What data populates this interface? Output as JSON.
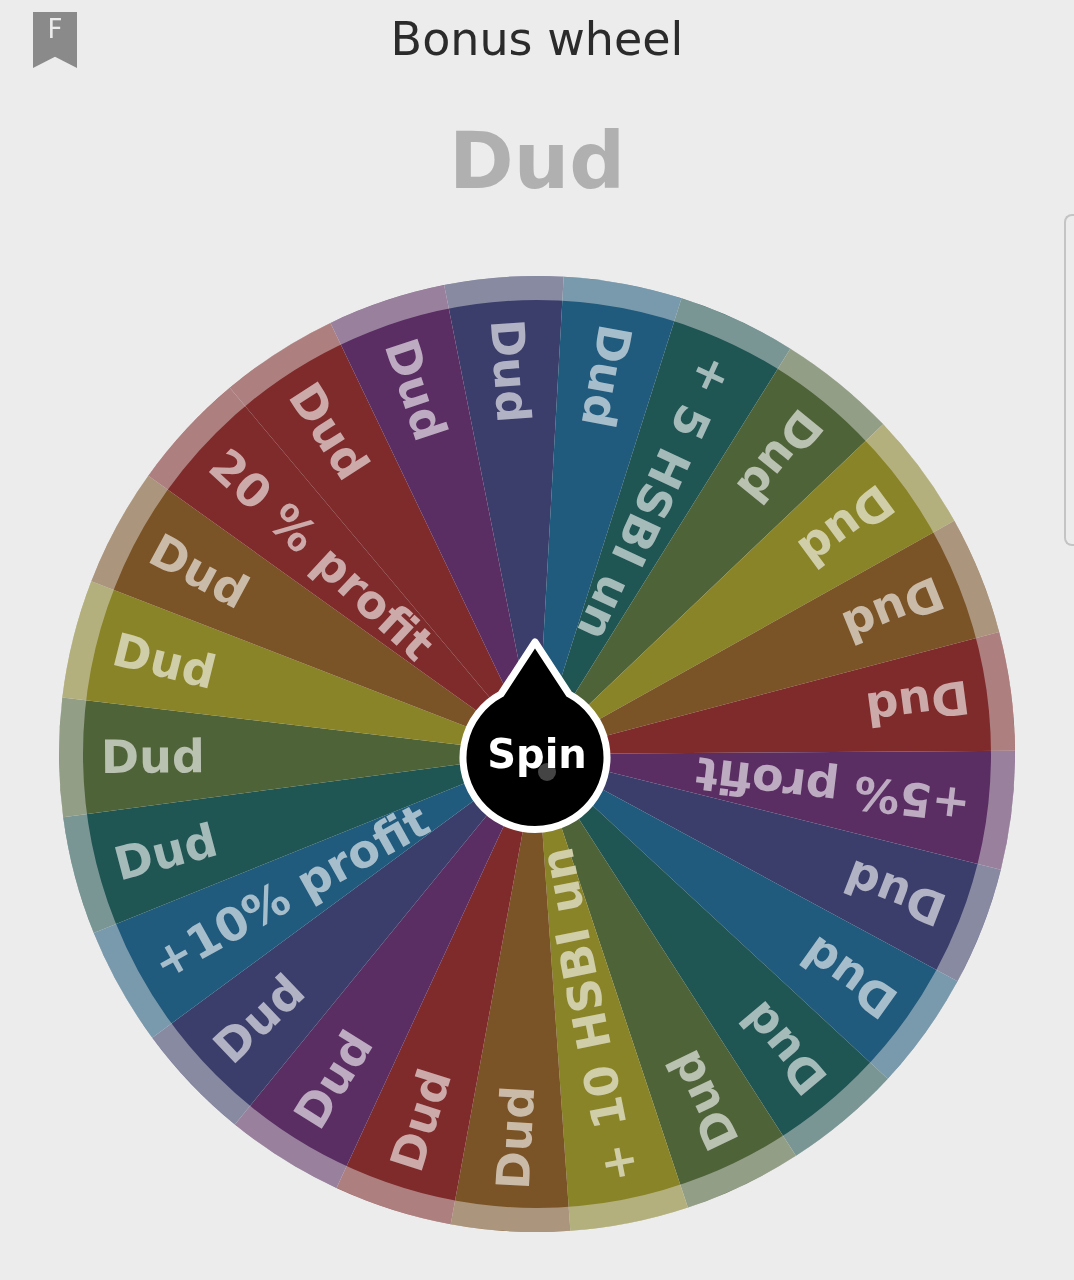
{
  "header": {
    "badge": "F",
    "title": "Bonus wheel"
  },
  "result": "Dud",
  "wheel": {
    "spin_label": "Spin",
    "segments": [
      {
        "label": "Dud",
        "color": "#3b3e6b"
      },
      {
        "label": "Dud",
        "color": "#205a7c"
      },
      {
        "label": "+ 5 HSBI un",
        "color": "#1f5553"
      },
      {
        "label": "Dud",
        "color": "#4f6339"
      },
      {
        "label": "Dud",
        "color": "#8a8428"
      },
      {
        "label": "Dud",
        "color": "#7a5326"
      },
      {
        "label": "Dud",
        "color": "#7f2b2b"
      },
      {
        "label": "+5% profit",
        "color": "#5a2e63"
      },
      {
        "label": "Dud",
        "color": "#3b3e6b"
      },
      {
        "label": "Dud",
        "color": "#205a7c"
      },
      {
        "label": "Dud",
        "color": "#1f5553"
      },
      {
        "label": "Dud",
        "color": "#4f6339"
      },
      {
        "label": "+ 10 HSBI un",
        "color": "#8a8428"
      },
      {
        "label": "Dud",
        "color": "#7a5326"
      },
      {
        "label": "Dud",
        "color": "#7f2b2b"
      },
      {
        "label": "Dud",
        "color": "#5a2e63"
      },
      {
        "label": "Dud",
        "color": "#3b3e6b"
      },
      {
        "label": "+10% profit",
        "color": "#205a7c"
      },
      {
        "label": "Dud",
        "color": "#1f5553"
      },
      {
        "label": "Dud",
        "color": "#4f6339"
      },
      {
        "label": "Dud",
        "color": "#8a8428"
      },
      {
        "label": "Dud",
        "color": "#7a5326"
      },
      {
        "label": "20 % profit",
        "color": "#7f2b2b"
      },
      {
        "label": "Dud",
        "color": "#7f2b2b"
      },
      {
        "label": "Dud",
        "color": "#5a2e63"
      }
    ]
  }
}
